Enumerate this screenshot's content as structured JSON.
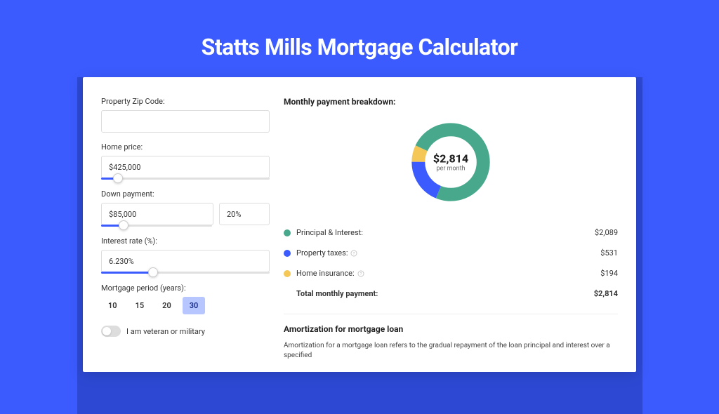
{
  "page_title": "Statts Mills Mortgage Calculator",
  "form": {
    "zip_label": "Property Zip Code:",
    "zip_value": "",
    "home_price_label": "Home price:",
    "home_price_value": "$425,000",
    "home_price_slider_pct": 10,
    "down_payment_label": "Down payment:",
    "down_payment_value": "$85,000",
    "down_payment_pct_value": "20%",
    "down_payment_slider_pct": 20,
    "interest_label": "Interest rate (%):",
    "interest_value": "6.230%",
    "interest_slider_pct": 31,
    "period_label": "Mortgage period (years):",
    "period_options": [
      "10",
      "15",
      "20",
      "30"
    ],
    "period_selected": "30",
    "veteran_label": "I am veteran or military",
    "veteran_on": false
  },
  "breakdown": {
    "title": "Monthly payment breakdown:",
    "center_amount": "$2,814",
    "center_sub": "per month",
    "items": [
      {
        "label": "Principal & Interest:",
        "value": "$2,089",
        "color": "#48A88B",
        "help": false
      },
      {
        "label": "Property taxes:",
        "value": "$531",
        "color": "#3B5BFE",
        "help": true
      },
      {
        "label": "Home insurance:",
        "value": "$194",
        "color": "#F4C757",
        "help": true
      }
    ],
    "total_label": "Total monthly payment:",
    "total_value": "$2,814"
  },
  "chart_data": {
    "type": "pie",
    "title": "Monthly payment breakdown",
    "series": [
      {
        "name": "Principal & Interest",
        "value": 2089,
        "color": "#48A88B"
      },
      {
        "name": "Property taxes",
        "value": 531,
        "color": "#3B5BFE"
      },
      {
        "name": "Home insurance",
        "value": 194,
        "color": "#F4C757"
      }
    ],
    "total": 2814,
    "unit": "USD per month"
  },
  "amortization": {
    "title": "Amortization for mortgage loan",
    "text": "Amortization for a mortgage loan refers to the gradual repayment of the loan principal and interest over a specified"
  }
}
